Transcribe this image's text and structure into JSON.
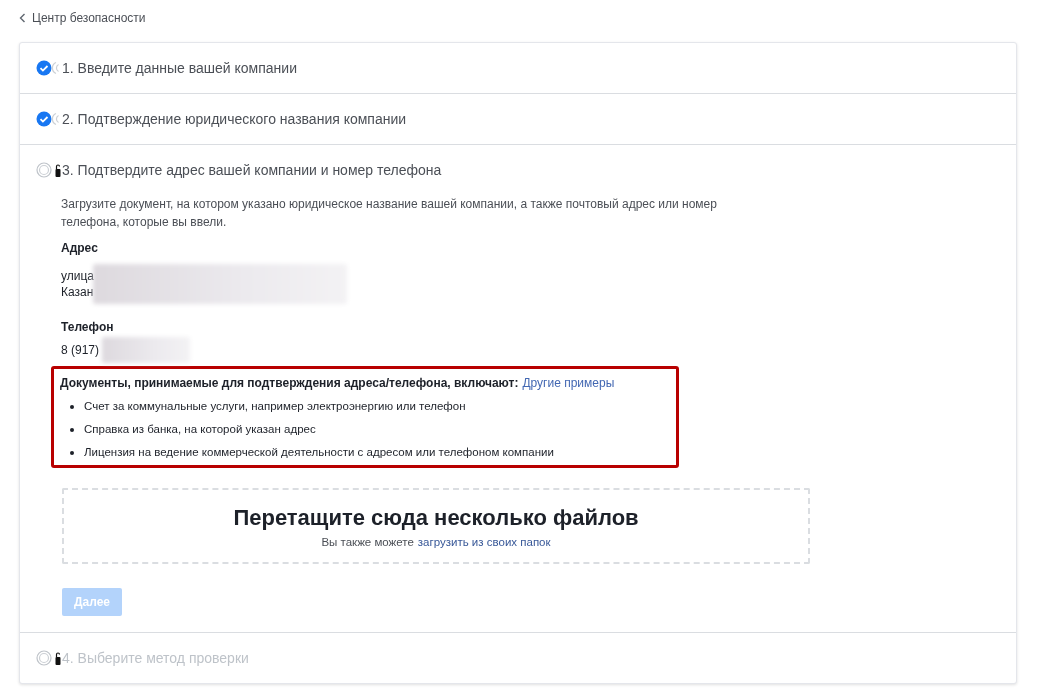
{
  "back_link": {
    "label": "Центр безопасности"
  },
  "steps": [
    {
      "title": "1. Введите данные вашей компании",
      "completed": true,
      "expanded": false,
      "disabled": false
    },
    {
      "title": "2. Подтверждение юридического названия компании",
      "completed": true,
      "expanded": false,
      "disabled": false
    },
    {
      "title": "3. Подтвердите адрес вашей компании и номер телефона",
      "completed": false,
      "expanded": true,
      "disabled": false
    },
    {
      "title": "4. Выберите метод проверки",
      "completed": false,
      "expanded": false,
      "disabled": true
    }
  ],
  "current_step": {
    "intro": "Загрузите документ, на котором указано юридическое название вашей компании, а также почтовый адрес или номер телефона, которые вы ввели.",
    "address_label": "Адрес",
    "address_lines": [
      "улица",
      "Казан"
    ],
    "phone_label": "Телефон",
    "phone": "8 (917)",
    "documents": {
      "heading": "Документы, принимаемые для подтверждения адреса/телефона, включают:",
      "link": "Другие примеры",
      "items": [
        "Счет за коммунальные услуги, например электроэнергию или телефон",
        "Справка из банка, на которой указан адрес",
        "Лицензия на ведение коммерческой деятельности с адресом или телефоном компании"
      ]
    },
    "dropzone": {
      "title": "Перетащите сюда несколько файлов",
      "hint": "Вы также можете",
      "link": "загрузить из своих папок"
    },
    "next_button": {
      "label": "Далее",
      "disabled": true
    }
  }
}
